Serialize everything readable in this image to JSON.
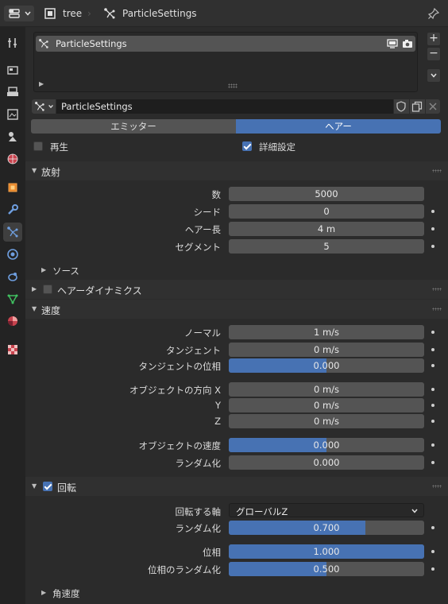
{
  "header": {
    "editor_label": "tree",
    "datablock_label": "ParticleSettings"
  },
  "particle_list": {
    "item_label": "ParticleSettings",
    "add_label": "+",
    "remove_label": "−"
  },
  "settings_selector": {
    "name": "ParticleSettings"
  },
  "type_switch": {
    "emitter": "エミッター",
    "hair": "ヘアー",
    "selected": "hair"
  },
  "options": {
    "regrow_label": "再生",
    "regrow_checked": false,
    "advanced_label": "詳細設定",
    "advanced_checked": true
  },
  "emission": {
    "title": "放射",
    "number_label": "数",
    "number_value": "5000",
    "seed_label": "シード",
    "seed_value": "0",
    "hair_length_label": "ヘアー長",
    "hair_length_value": "4 m",
    "segments_label": "セグメント",
    "segments_value": "5",
    "source_label": "ソース"
  },
  "hair_dynamics": {
    "title": "ヘアーダイナミクス",
    "enabled": false
  },
  "velocity": {
    "title": "速度",
    "normal_label": "ノーマル",
    "normal_value": "1 m/s",
    "tangent_label": "タンジェント",
    "tangent_value": "0 m/s",
    "tangent_phase_label": "タンジェントの位相",
    "tangent_phase_value": "0.000",
    "tangent_phase_fraction": 0.5,
    "obj_align_x_label": "オブジェクトの方向 X",
    "obj_align_x_value": "0 m/s",
    "obj_align_y_label": "Y",
    "obj_align_y_value": "0 m/s",
    "obj_align_z_label": "Z",
    "obj_align_z_value": "0 m/s",
    "object_velocity_label": "オブジェクトの速度",
    "object_velocity_value": "0.000",
    "object_velocity_fraction": 0.5,
    "randomize_label": "ランダム化",
    "randomize_value": "0.000"
  },
  "rotation": {
    "title": "回転",
    "enabled": true,
    "axis_label": "回転する軸",
    "axis_value": "グローバルZ",
    "randomize_label": "ランダム化",
    "randomize_value": "0.700",
    "randomize_fraction": 0.7,
    "phase_label": "位相",
    "phase_value": "1.000",
    "phase_fraction": 1.0,
    "phase_random_label": "位相のランダム化",
    "phase_random_value": "0.500",
    "phase_random_fraction": 0.5,
    "angular_velocity_label": "角速度"
  },
  "colors": {
    "accent": "#4772b3",
    "field": "#545454",
    "background": "#2b2b2b"
  }
}
